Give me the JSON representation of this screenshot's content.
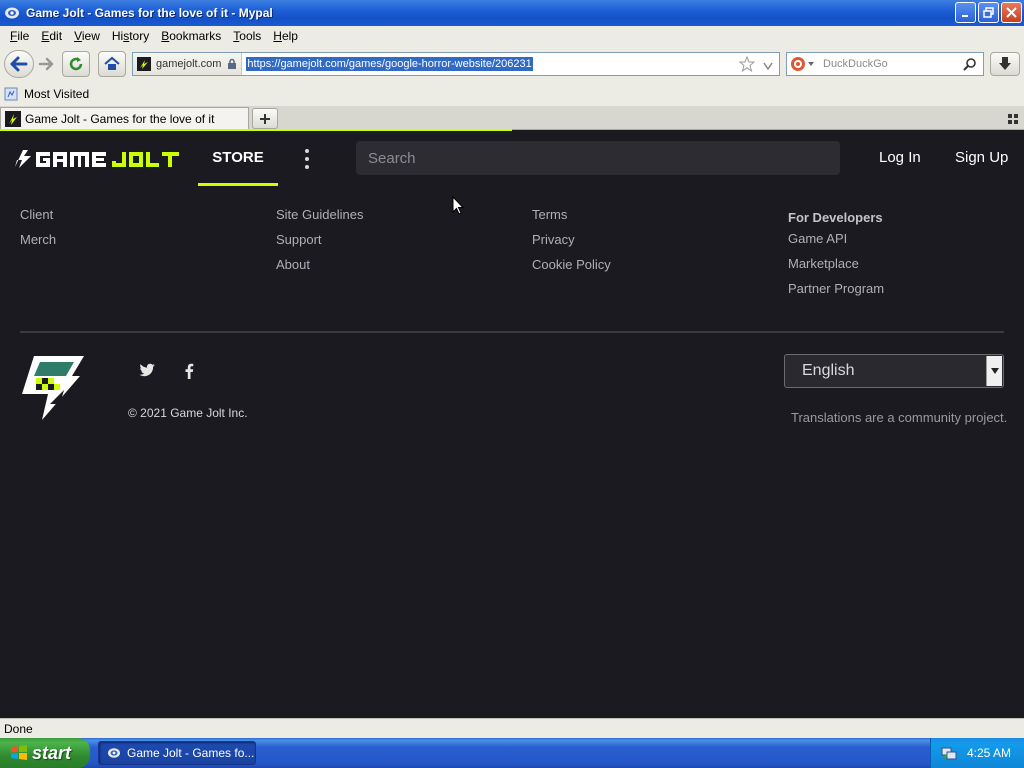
{
  "window": {
    "title": "Game Jolt - Games for the love of it - Mypal"
  },
  "menubar": {
    "items": [
      {
        "u": "F",
        "rest": "ile"
      },
      {
        "u": "E",
        "rest": "dit"
      },
      {
        "u": "V",
        "rest": "iew"
      },
      {
        "u": "",
        "pre": "Hi",
        "u2": "s",
        "rest": "tory"
      },
      {
        "u": "B",
        "rest": "ookmarks"
      },
      {
        "u": "T",
        "rest": "ools"
      },
      {
        "u": "H",
        "rest": "elp"
      }
    ]
  },
  "navbar": {
    "identity_site": "gamejolt.com",
    "url": "https://gamejolt.com/games/google-horror-website/206231",
    "search_placeholder": "DuckDuckGo"
  },
  "bookmarks": {
    "most_visited": "Most Visited"
  },
  "tabs": [
    {
      "label": "Game Jolt - Games for the love of it"
    }
  ],
  "loading_progress": 0.5,
  "site": {
    "nav": {
      "store": "STORE",
      "search_placeholder": "Search",
      "login": "Log In",
      "signup": "Sign Up"
    },
    "footer": {
      "col1": [
        "Client",
        "Merch"
      ],
      "col2": [
        "Site Guidelines",
        "Support",
        "About"
      ],
      "col3": [
        "Terms",
        "Privacy",
        "Cookie Policy"
      ],
      "col4_heading": "For Developers",
      "col4": [
        "Game API",
        "Marketplace",
        "Partner Program"
      ],
      "copyright": "© 2021 Game Jolt Inc.",
      "language": "English",
      "translations_note": "Translations are a community project."
    }
  },
  "statusbar": {
    "text": "Done"
  },
  "taskbar": {
    "start_label": "start",
    "task_label": "Game Jolt - Games fo...",
    "clock": "4:25 AM"
  },
  "colors": {
    "brand_accent": "#ccff00",
    "page_bg": "#1b1a20"
  }
}
